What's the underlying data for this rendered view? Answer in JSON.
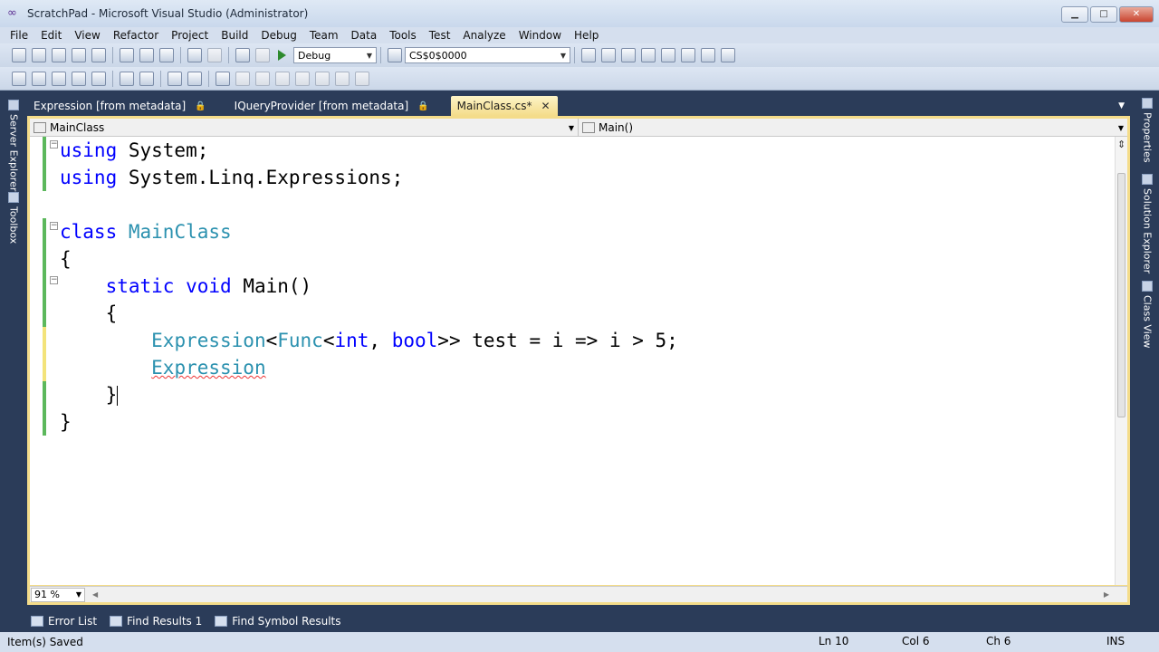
{
  "window": {
    "title": "ScratchPad - Microsoft Visual Studio (Administrator)",
    "buttons": [
      "minimize",
      "maximize",
      "close"
    ]
  },
  "menu": [
    "File",
    "Edit",
    "View",
    "Refactor",
    "Project",
    "Build",
    "Debug",
    "Team",
    "Data",
    "Tools",
    "Test",
    "Analyze",
    "Window",
    "Help"
  ],
  "toolbar": {
    "config_value": "Debug",
    "search_value": "CS$0$0000"
  },
  "tabs": [
    {
      "label": "Expression [from metadata]",
      "active": false
    },
    {
      "label": "IQueryProvider [from metadata]",
      "active": false
    },
    {
      "label": "MainClass.cs*",
      "active": true
    }
  ],
  "nav": {
    "class_value": "MainClass",
    "member_value": "Main()"
  },
  "code": {
    "lines": [
      [
        {
          "t": "using",
          "c": "kw"
        },
        {
          "t": " System;",
          "c": ""
        }
      ],
      [
        {
          "t": "using",
          "c": "kw"
        },
        {
          "t": " System.Linq.Expressions;",
          "c": ""
        }
      ],
      [],
      [
        {
          "t": "class",
          "c": "kw"
        },
        {
          "t": " ",
          "c": ""
        },
        {
          "t": "MainClass",
          "c": "tp"
        }
      ],
      [
        {
          "t": "{",
          "c": ""
        }
      ],
      [
        {
          "t": "    ",
          "c": ""
        },
        {
          "t": "static",
          "c": "kw"
        },
        {
          "t": " ",
          "c": ""
        },
        {
          "t": "void",
          "c": "kw"
        },
        {
          "t": " Main()",
          "c": ""
        }
      ],
      [
        {
          "t": "    {",
          "c": ""
        }
      ],
      [
        {
          "t": "        ",
          "c": ""
        },
        {
          "t": "Expression",
          "c": "tp"
        },
        {
          "t": "<",
          "c": ""
        },
        {
          "t": "Func",
          "c": "tp"
        },
        {
          "t": "<",
          "c": ""
        },
        {
          "t": "int",
          "c": "kw"
        },
        {
          "t": ", ",
          "c": ""
        },
        {
          "t": "bool",
          "c": "kw"
        },
        {
          "t": ">> test = i => i > 5;",
          "c": ""
        }
      ],
      [
        {
          "t": "        ",
          "c": ""
        },
        {
          "t": "Expression",
          "c": "tp squiggle"
        }
      ],
      [
        {
          "t": "    }",
          "c": ""
        }
      ],
      [
        {
          "t": "}",
          "c": ""
        }
      ]
    ]
  },
  "zoom": "91 %",
  "bottom_tabs": [
    "Error List",
    "Find Results 1",
    "Find Symbol Results"
  ],
  "left_rail": [
    "Server Explorer",
    "Toolbox"
  ],
  "right_rail": [
    "Properties",
    "Solution Explorer",
    "Class View"
  ],
  "status": {
    "message": "Item(s) Saved",
    "ln": "Ln 10",
    "col": "Col 6",
    "ch": "Ch 6",
    "mode": "INS"
  }
}
